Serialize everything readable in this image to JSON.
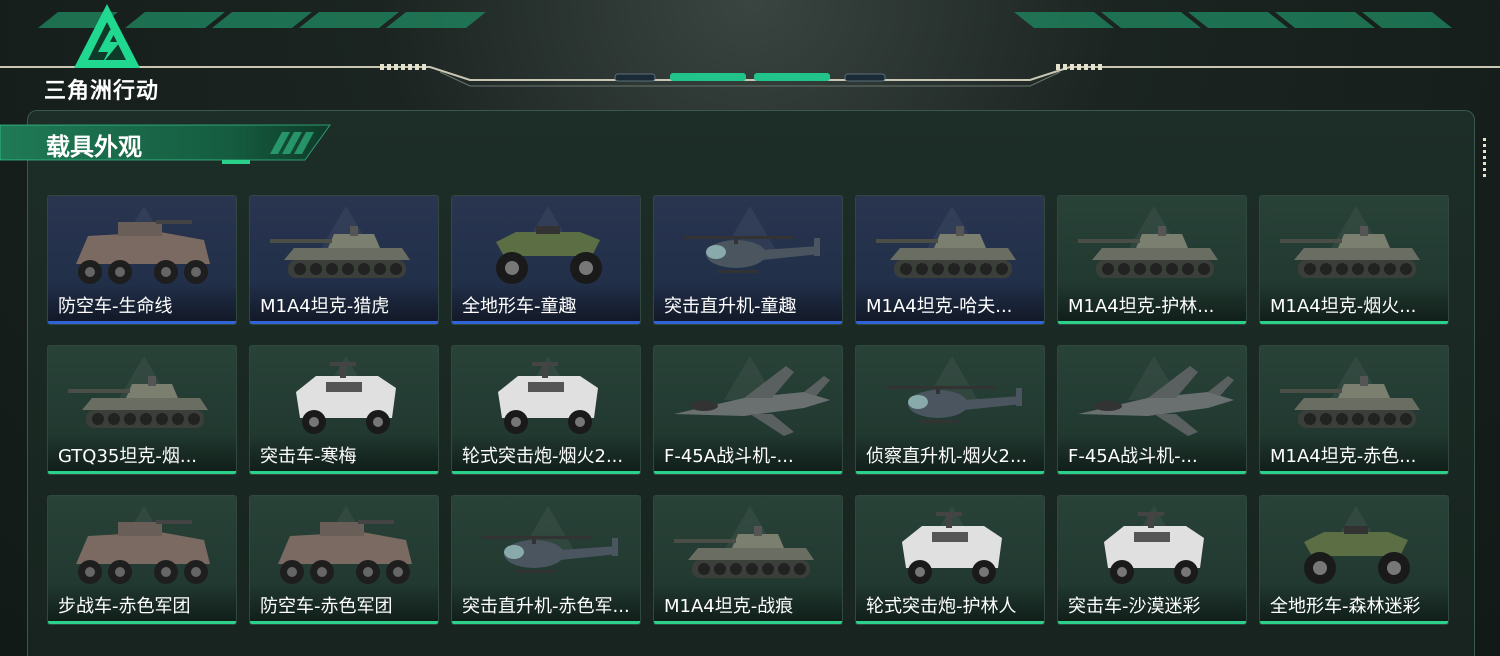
{
  "app": {
    "logo_text": "三角洲行动"
  },
  "section": {
    "title": "载具外观"
  },
  "colors": {
    "accent_green": "#2bd18a",
    "accent_blue": "#2f63d6",
    "panel_border": "#3b5a4d"
  },
  "vehicles": [
    {
      "label": "防空车-生命线",
      "rarity": "blue",
      "icon": "apc-icon"
    },
    {
      "label": "M1A4坦克-猎虎",
      "rarity": "blue",
      "icon": "tank-icon"
    },
    {
      "label": "全地形车-童趣",
      "rarity": "blue",
      "icon": "atv-icon"
    },
    {
      "label": "突击直升机-童趣",
      "rarity": "blue",
      "icon": "helicopter-icon"
    },
    {
      "label": "M1A4坦克-哈夫...",
      "rarity": "blue",
      "icon": "tank-icon"
    },
    {
      "label": "M1A4坦克-护林...",
      "rarity": "green",
      "icon": "tank-icon"
    },
    {
      "label": "M1A4坦克-烟火...",
      "rarity": "green",
      "icon": "tank-icon"
    },
    {
      "label": "GTQ35坦克-烟...",
      "rarity": "green",
      "icon": "tank-icon"
    },
    {
      "label": "突击车-寒梅",
      "rarity": "green",
      "icon": "assault-vehicle-icon"
    },
    {
      "label": "轮式突击炮-烟火2...",
      "rarity": "green",
      "icon": "assault-vehicle-icon"
    },
    {
      "label": "F-45A战斗机-...",
      "rarity": "green",
      "icon": "jet-icon"
    },
    {
      "label": "侦察直升机-烟火2...",
      "rarity": "green",
      "icon": "helicopter-icon"
    },
    {
      "label": "F-45A战斗机-...",
      "rarity": "green",
      "icon": "jet-icon"
    },
    {
      "label": "M1A4坦克-赤色...",
      "rarity": "green",
      "icon": "tank-icon"
    },
    {
      "label": "步战车-赤色军团",
      "rarity": "green",
      "icon": "apc-icon"
    },
    {
      "label": "防空车-赤色军团",
      "rarity": "green",
      "icon": "apc-icon"
    },
    {
      "label": "突击直升机-赤色军...",
      "rarity": "green",
      "icon": "helicopter-icon"
    },
    {
      "label": "M1A4坦克-战痕",
      "rarity": "green",
      "icon": "tank-icon"
    },
    {
      "label": "轮式突击炮-护林人",
      "rarity": "green",
      "icon": "assault-vehicle-icon"
    },
    {
      "label": "突击车-沙漠迷彩",
      "rarity": "green",
      "icon": "assault-vehicle-icon"
    },
    {
      "label": "全地形车-森林迷彩",
      "rarity": "green",
      "icon": "atv-icon"
    }
  ]
}
